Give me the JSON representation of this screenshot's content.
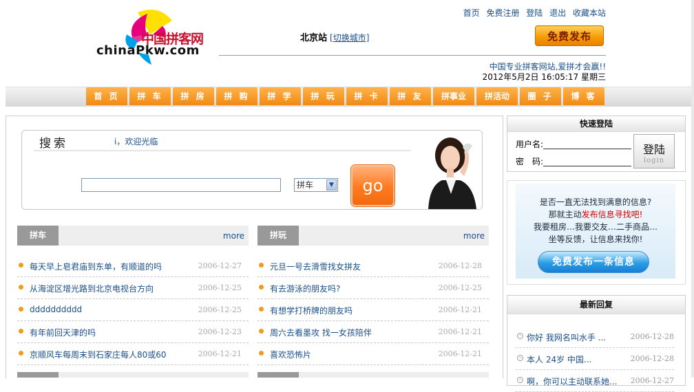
{
  "header": {
    "top_links": [
      "首页",
      "免费注册",
      "登陆",
      "退出",
      "收藏本站"
    ],
    "logo_cn": "中国拼客网",
    "logo_en": "chinaPkw.com",
    "city": "北京站",
    "switch_city": "[切换城市]",
    "publish_button": "免费发布",
    "slogan": "中国专业拼客网站,爱拼才会赢!!",
    "datetime": "2012年5月2日 16:05:17 星期三"
  },
  "nav": [
    "首 页",
    "拼 车",
    "拼 房",
    "拼 购",
    "拼 学",
    "拼 玩",
    "拼 卡",
    "拼 友",
    "拼事业",
    "拼活动",
    "圈 子",
    "博 客"
  ],
  "search": {
    "label": "搜索",
    "welcome": "i，欢迎光临",
    "input_value": "",
    "select_value": "拼车",
    "go_button": "go"
  },
  "sections": [
    {
      "tab": "拼车",
      "more": "more",
      "items": [
        {
          "title": "每天早上皂君庙到东单，有顺道的吗",
          "date": "2006-12-27"
        },
        {
          "title": "从海淀区增光路到北京电视台方向",
          "date": "2006-12-25"
        },
        {
          "title": "dddddddddd",
          "date": "2006-12-25"
        },
        {
          "title": "有年前回天津的吗",
          "date": "2006-12-23"
        },
        {
          "title": "京顺风车每周末到石家庄每人80或60",
          "date": "2006-12-21"
        }
      ]
    },
    {
      "tab": "拼玩",
      "more": "more",
      "items": [
        {
          "title": "元旦一号去滑雪找女拼友",
          "date": "2006-12-28"
        },
        {
          "title": "有去游泳的朋友吗?",
          "date": "2006-12-25"
        },
        {
          "title": "有想学打桥牌的朋友吗",
          "date": "2006-12-21"
        },
        {
          "title": "周六去看墨攻 找一女孩陪伴",
          "date": "2006-12-21"
        },
        {
          "title": "喜欢恐怖片",
          "date": "2006-12-21"
        }
      ]
    }
  ],
  "login": {
    "title": "快速登陆",
    "username_label": "用户名:",
    "password_label": "密　码:",
    "button": "登陆",
    "button_sub": "login"
  },
  "info": {
    "line1": "是否一直无法找到满意的信息?",
    "line2_pre": "那就主动",
    "line2_red": "发布信息寻找吧!",
    "line3": "我要租房…我要交友…二手商品…",
    "line4": "坐等反馈，让信息来找你!",
    "button": "免费发布一条信息"
  },
  "replies": {
    "title": "最新回复",
    "items": [
      {
        "title": "你好 我网名叫水手 ...",
        "date": "2006-12-28"
      },
      {
        "title": "本人 24岁 中国...",
        "date": "2006-12-28"
      },
      {
        "title": "啊，你可以主动联系她...",
        "date": "2006-12-27"
      }
    ]
  },
  "colors": {
    "nav_orange": "#f08a14",
    "link_blue": "#1a4f8a",
    "tab_gray": "#999999",
    "bullet_orange": "#f39a1e"
  }
}
